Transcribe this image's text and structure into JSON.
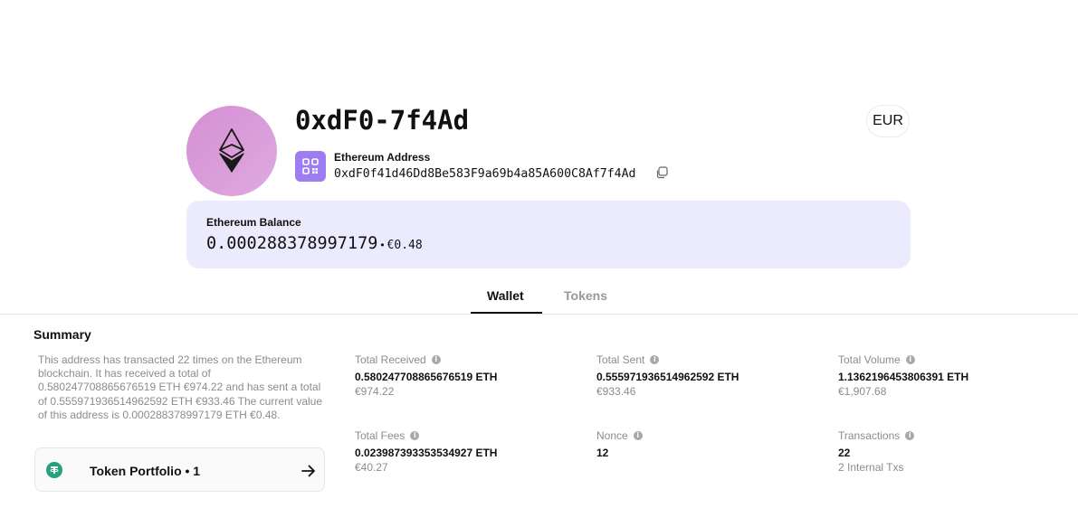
{
  "header": {
    "short_address": "0xdF0-7f4Ad",
    "address_label": "Ethereum Address",
    "full_address": "0xdF0f41d46Dd8Be583F9a69b4a85A600C8Af7f4Ad",
    "currency": "EUR"
  },
  "balance": {
    "label": "Ethereum Balance",
    "value": "0.000288378997179",
    "separator": "•",
    "fiat": "€0.48"
  },
  "tabs": [
    {
      "label": "Wallet",
      "active": true
    },
    {
      "label": "Tokens",
      "active": false
    }
  ],
  "summary": {
    "title": "Summary",
    "text": "This address has transacted 22 times on the Ethereum blockchain. It has received a total of 0.580247708865676519 ETH €974.22 and has sent a total of 0.555971936514962592 ETH €933.46 The current value of this address is 0.000288378997179 ETH €0.48.",
    "portfolio_label": "Token Portfolio • 1"
  },
  "stats": {
    "total_received": {
      "label": "Total Received",
      "value": "0.580247708865676519 ETH",
      "sub": "€974.22"
    },
    "total_sent": {
      "label": "Total Sent",
      "value": "0.555971936514962592 ETH",
      "sub": "€933.46"
    },
    "total_volume": {
      "label": "Total Volume",
      "value": "1.1362196453806391 ETH",
      "sub": "€1,907.68"
    },
    "total_fees": {
      "label": "Total Fees",
      "value": "0.023987393353534927 ETH",
      "sub": "€40.27"
    },
    "nonce": {
      "label": "Nonce",
      "value": "12",
      "sub": ""
    },
    "transactions": {
      "label": "Transactions",
      "value": "22",
      "sub": "2 Internal Txs"
    }
  },
  "icons": {
    "avatar": "ethereum-icon",
    "qr": "qr-code-icon",
    "copy": "copy-icon",
    "info": "info-icon",
    "token": "tether-icon",
    "arrow": "arrow-right-icon"
  },
  "colors": {
    "avatar_bg": "#d58fd3",
    "qr_bg": "#9c7ef0",
    "balance_card_bg": "#ecebfd",
    "tether": "#26a17b"
  }
}
